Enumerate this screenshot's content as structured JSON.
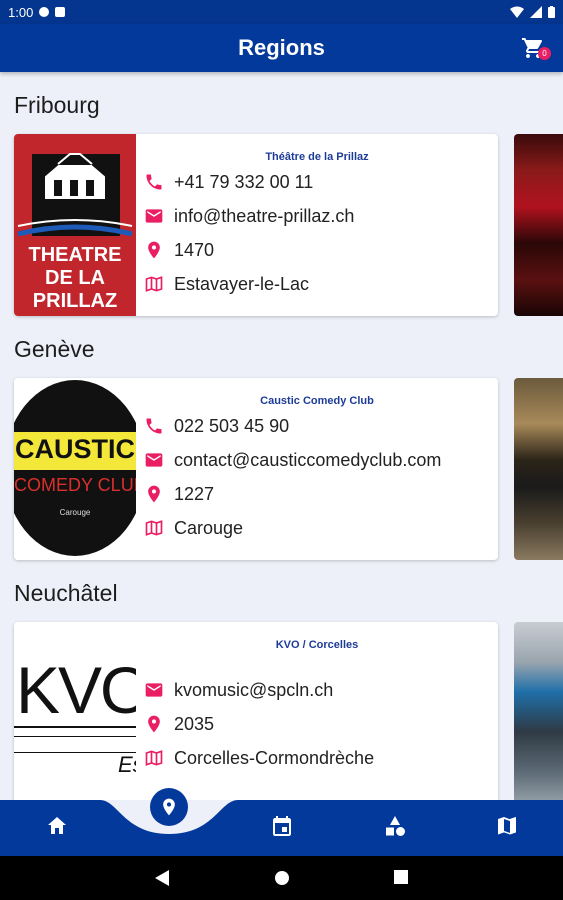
{
  "status_bar": {
    "time": "1:00"
  },
  "app_bar": {
    "title": "Regions",
    "cart_count": "0",
    "cart_icon": "cart-icon"
  },
  "regions": [
    {
      "name": "Fribourg",
      "venue": {
        "name": "Théâtre de la Prillaz",
        "phone": "+41 79 332 00 11",
        "email": "info@theatre-prillaz.ch",
        "postal": "1470",
        "city": "Estavayer-le-Lac",
        "logo_text": [
          "THEATRE",
          "DE LA",
          "PRILLAZ"
        ]
      }
    },
    {
      "name": "Genève",
      "venue": {
        "name": "Caustic Comedy Club",
        "phone": "022 503 45 90",
        "email": "contact@causticcomedyclub.com",
        "postal": "1227",
        "city": "Carouge",
        "logo_text": [
          "CAUSTIC",
          "COMEDY CLUB",
          "Carouge"
        ]
      }
    },
    {
      "name": "Neuchâtel",
      "venue": {
        "name": "KVO / Corcelles",
        "email": "kvomusic@spcln.ch",
        "postal": "2035",
        "city": "Corcelles-Cormondrèche",
        "logo_text": [
          "KVO",
          "Es"
        ]
      }
    }
  ],
  "bottom_nav": {
    "items": [
      "home-icon",
      "location-pin-icon",
      "calendar-icon",
      "shapes-icon",
      "map-icon"
    ],
    "active": "location-pin-icon"
  },
  "colors": {
    "primary": "#04399c",
    "accent_icon": "#e91e63",
    "background": "#eef0f9",
    "venue_title": "#1d3c98"
  }
}
